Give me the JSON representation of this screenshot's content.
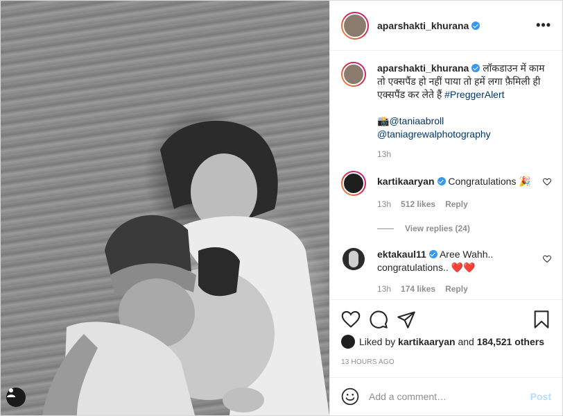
{
  "post": {
    "author": "aparshakti_khurana",
    "verified": true,
    "more_icon": "more-horizontal-icon",
    "caption": {
      "text": "लॉकडाउन में काम तो एक्सपैंड हो नहीं पाया तो हमें लगा फ़ैमिली ही एक्सपैंड कर लेते हैं",
      "hashtag": "#PreggerAlert",
      "camera_emoji": "📸",
      "mention1": "@taniaabroll",
      "mention2": "@taniagrewalphotography",
      "time": "13h"
    },
    "comments": [
      {
        "user": "kartikaaryan",
        "text": "Congratulations 🎉",
        "time": "13h",
        "likes": "512 likes",
        "reply": "Reply",
        "view_replies": "View replies (24)"
      },
      {
        "user": "ektakaul11",
        "text_line1": "Aree Wahh..",
        "text_line2": "congratulations..",
        "hearts": "❤️❤️",
        "time": "13h",
        "likes": "174 likes",
        "reply": "Reply"
      }
    ],
    "liked_by": {
      "prefix": "Liked by",
      "user": "kartikaaryan",
      "and": "and",
      "others": "184,521 others"
    },
    "timestamp": "13 HOURS AGO",
    "add_comment": {
      "placeholder": "Add a comment…",
      "post_label": "Post"
    }
  },
  "colors": {
    "accent": "#3897f0",
    "link": "#00376b",
    "muted": "#8e8e8e",
    "post_disabled": "#b2dffc",
    "heart_red": "#ed4956"
  }
}
